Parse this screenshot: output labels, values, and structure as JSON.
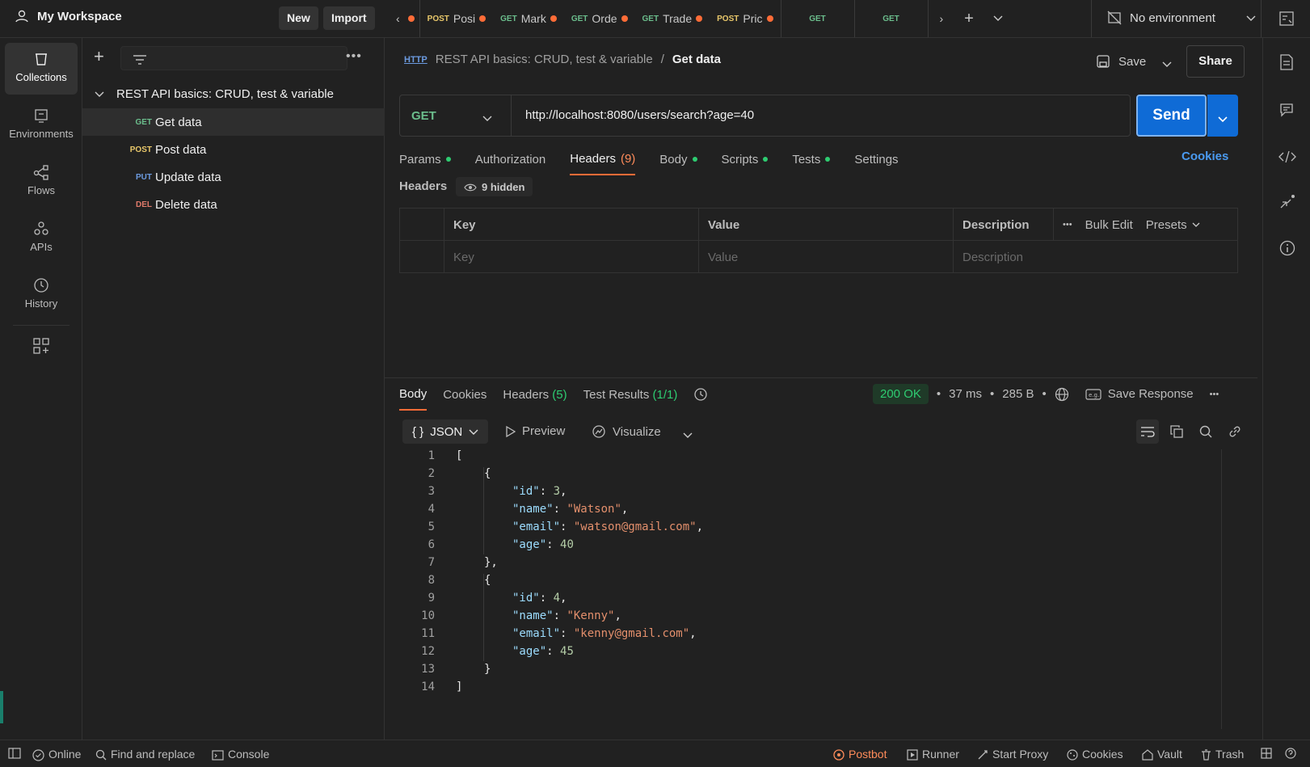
{
  "topbar": {
    "workspace": "My Workspace",
    "new_label": "New",
    "import_label": "Import",
    "tabs": [
      {
        "method": "POST",
        "label": "Posi"
      },
      {
        "method": "GET",
        "label": "Mark"
      },
      {
        "method": "GET",
        "label": "Orde"
      },
      {
        "method": "GET",
        "label": "Trade"
      },
      {
        "method": "POST",
        "label": "Pric"
      },
      {
        "method": "GET",
        "label": ""
      },
      {
        "method": "GET",
        "label": ""
      }
    ],
    "environment": "No environment"
  },
  "leftnav": {
    "items": [
      {
        "label": "Collections",
        "icon": "collections-icon"
      },
      {
        "label": "Environments",
        "icon": "environments-icon"
      },
      {
        "label": "Flows",
        "icon": "flows-icon"
      },
      {
        "label": "APIs",
        "icon": "apis-icon"
      },
      {
        "label": "History",
        "icon": "history-icon"
      }
    ]
  },
  "sidebar": {
    "collection": "REST API basics: CRUD, test & variable",
    "requests": [
      {
        "method": "GET",
        "label": "Get data"
      },
      {
        "method": "POST",
        "label": "Post data"
      },
      {
        "method": "PUT",
        "label": "Update data"
      },
      {
        "method": "DEL",
        "label": "Delete data"
      }
    ]
  },
  "request": {
    "breadcrumb_parent": "REST API basics: CRUD, test & variable",
    "breadcrumb_sep": "/",
    "title": "Get data",
    "save_label": "Save",
    "share_label": "Share",
    "method": "GET",
    "url": "http://localhost:8080/users/search?age=40",
    "send_label": "Send",
    "tabs": {
      "params": "Params",
      "authorization": "Authorization",
      "headers": "Headers",
      "headers_count": "(9)",
      "body": "Body",
      "scripts": "Scripts",
      "tests": "Tests",
      "settings": "Settings"
    },
    "cookies_label": "Cookies",
    "headers_section": "Headers",
    "hidden_label": "9 hidden",
    "table": {
      "col_key": "Key",
      "col_value": "Value",
      "col_description": "Description",
      "bulk_edit": "Bulk Edit",
      "presets": "Presets",
      "ph_key": "Key",
      "ph_value": "Value",
      "ph_description": "Description"
    }
  },
  "response": {
    "tabs": {
      "body": "Body",
      "cookies": "Cookies",
      "headers": "Headers",
      "headers_count": "(5)",
      "tests": "Test Results",
      "tests_count": "(1/1)"
    },
    "status": "200 OK",
    "time": "37 ms",
    "size": "285 B",
    "save_response": "Save Response",
    "format": "JSON",
    "preview": "Preview",
    "visualize": "Visualize",
    "lines": [
      "1",
      "2",
      "3",
      "4",
      "5",
      "6",
      "7",
      "8",
      "9",
      "10",
      "11",
      "12",
      "13",
      "14"
    ],
    "code": {
      "open_arr": "[",
      "open_obj": "{",
      "close_obj_comma": "},",
      "close_obj": "}",
      "close_arr": "]",
      "k_id": "\"id\"",
      "k_name": "\"name\"",
      "k_email": "\"email\"",
      "k_age": "\"age\"",
      "u1_id": "3",
      "u1_name": "\"Watson\"",
      "u1_email": "\"watson@gmail.com\"",
      "u1_age": "40",
      "u2_id": "4",
      "u2_name": "\"Kenny\"",
      "u2_email": "\"kenny@gmail.com\"",
      "u2_age": "45"
    }
  },
  "statusbar": {
    "online": "Online",
    "find": "Find and replace",
    "console": "Console",
    "postbot": "Postbot",
    "runner": "Runner",
    "proxy": "Start Proxy",
    "cookies": "Cookies",
    "vault": "Vault",
    "trash": "Trash"
  },
  "colors": {
    "accent": "#ff6c37",
    "send": "#0f6bd6",
    "get": "#6bbd8c",
    "post": "#e8c76a",
    "ok": "#2ecc71"
  }
}
